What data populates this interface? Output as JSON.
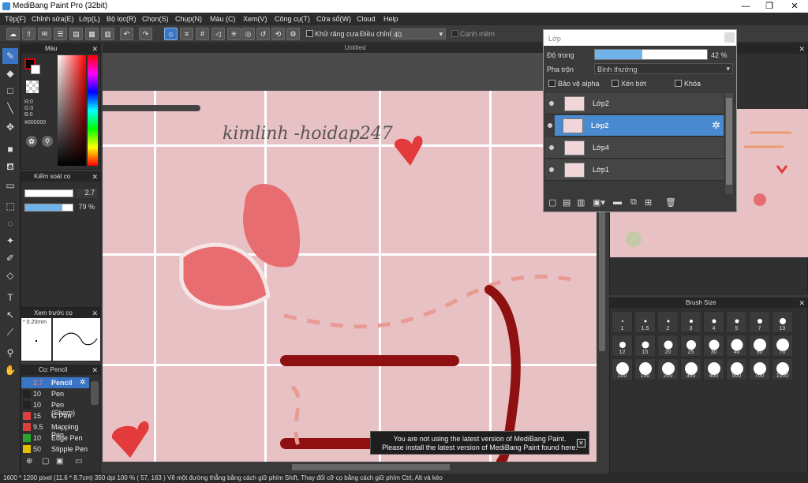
{
  "window": {
    "title": "MediBang Paint Pro (32bit)",
    "minimize": "—",
    "maximize": "❐",
    "close": "✕"
  },
  "menu": [
    "Tệp(F)",
    "Chỉnh sửa(E)",
    "Lớp(L)",
    "Bộ lọc(R)",
    "Chọn(S)",
    "Chụp(N)",
    "Màu (C)",
    "Xem(V)",
    "Công cụ(T)",
    "Cửa sổ(W)",
    "Cloud",
    "Help"
  ],
  "toolbar": {
    "antialias_label": "Khử răng cưa",
    "adjust_label": "Điều chỉnh",
    "adjust_value": "40",
    "smooth_edge_label": "Cạnh mềm"
  },
  "color_panel": {
    "title": "Màu",
    "r": "R:0",
    "g": "G:0",
    "b": "B:0",
    "hex": "#000000"
  },
  "brush_control": {
    "title": "Kiểm soát cọ",
    "size": "2.7",
    "opacity": "79 %",
    "opacity_fraction": 0.79
  },
  "brush_preview": {
    "title": "Xem trước cọ",
    "size": "* 0.20mm"
  },
  "brush_list": {
    "title": "Cọ: Pencil",
    "items": [
      {
        "size": "2.7",
        "name": "Pencil",
        "color": "#3a74c4",
        "selected": true
      },
      {
        "size": "10",
        "name": "Pen",
        "color": "#222222"
      },
      {
        "size": "10",
        "name": "Pen (Sharp)",
        "color": "#222222"
      },
      {
        "size": "15",
        "name": "G Pen",
        "color": "#e03c3c"
      },
      {
        "size": "9.5",
        "name": "Mapping Pen",
        "color": "#e03c3c"
      },
      {
        "size": "10",
        "name": "Edge Pen",
        "color": "#2aa52a"
      },
      {
        "size": "50",
        "name": "Stipple Pen",
        "color": "#e0c000"
      }
    ]
  },
  "document": {
    "tab": "Untitled",
    "watermark_text": "kimlinh -hoidap247"
  },
  "layer_panel": {
    "title": "Lớp",
    "opacity_label": "Độ trong",
    "opacity_value": "42 %",
    "opacity_fraction": 0.42,
    "blend_label": "Pha trộn",
    "blend_value": "Bình thường",
    "protect_alpha": "Bảo vệ alpha",
    "clip": "Xén bớt",
    "lock": "Khóa",
    "layers": [
      {
        "name": "Lớp2",
        "selected": false
      },
      {
        "name": "Lớp2",
        "selected": true
      },
      {
        "name": "Lớp4",
        "selected": false
      },
      {
        "name": "Lớp1",
        "selected": false
      }
    ]
  },
  "brush_size_panel": {
    "title": "Brush Size",
    "sizes": [
      "1",
      "1.5",
      "2",
      "3",
      "4",
      "5",
      "7",
      "10",
      "12",
      "15",
      "20",
      "25",
      "30",
      "40",
      "50",
      "70",
      "100",
      "150",
      "200",
      "300",
      "400",
      "500",
      "700",
      "1000"
    ]
  },
  "notification": {
    "line1": "You are not using the latest version of MediBang Paint.",
    "line2": "Please install the latest version of MediBang Paint found here.",
    "close": "✕"
  },
  "status": {
    "text": "1600 * 1200 pixel   (11.6 * 8.7cm)   350 dpi   100 %   ( 57, 163 )   Vẽ một đường thẳng bằng cách giữ phím Shift, Thay đổi cỡ cọ bằng cách giữ phím Ctrl, Alt và kéo"
  }
}
